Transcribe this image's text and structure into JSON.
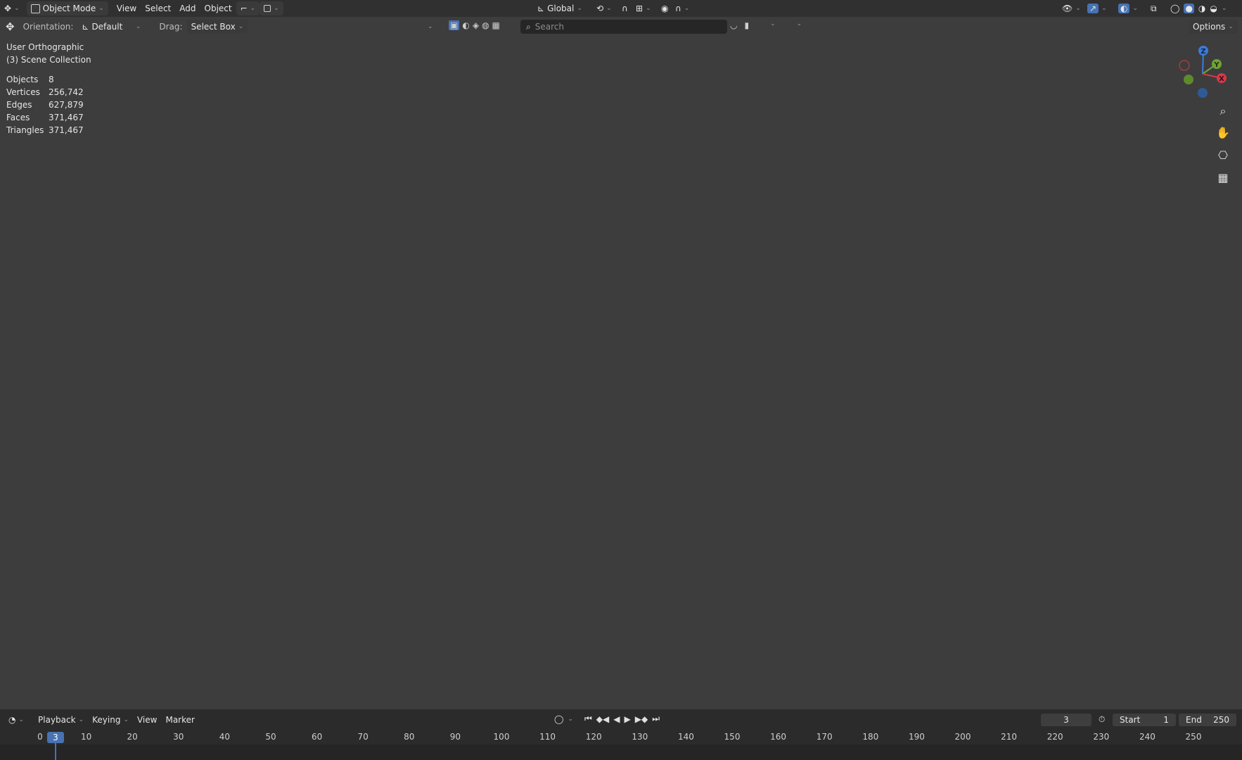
{
  "header": {
    "mode": "Object Mode",
    "menus": [
      "View",
      "Select",
      "Add",
      "Object"
    ],
    "transform_orientation": "Global",
    "options_label": "Options"
  },
  "tool_settings": {
    "orientation_label": "Orientation:",
    "orientation_value": "Default",
    "drag_label": "Drag:",
    "drag_value": "Select Box",
    "search_placeholder": "Search"
  },
  "viewport": {
    "view_name": "User Orthographic",
    "collection": "(3) Scene Collection",
    "stats": [
      {
        "label": "Objects",
        "value": "8"
      },
      {
        "label": "Vertices",
        "value": "256,742"
      },
      {
        "label": "Edges",
        "value": "627,879"
      },
      {
        "label": "Faces",
        "value": "371,467"
      },
      {
        "label": "Triangles",
        "value": "371,467"
      }
    ],
    "gizmo": {
      "z": "Z",
      "y": "Y",
      "x": "X"
    },
    "colors": {
      "background": "#3d3d3d",
      "x_axis": "#b43c3c",
      "y_axis": "#6a9a2f",
      "model": "#8e8e8e"
    }
  },
  "timeline": {
    "menus": [
      "Playback",
      "Keying",
      "View",
      "Marker"
    ],
    "current_frame": "3",
    "start_label": "Start",
    "start_value": "1",
    "end_label": "End",
    "end_value": "250",
    "ruler": [
      "0",
      "10",
      "20",
      "30",
      "40",
      "50",
      "60",
      "70",
      "80",
      "90",
      "100",
      "110",
      "120",
      "130",
      "140",
      "150",
      "160",
      "170",
      "180",
      "190",
      "200",
      "210",
      "220",
      "230",
      "240",
      "250"
    ]
  }
}
